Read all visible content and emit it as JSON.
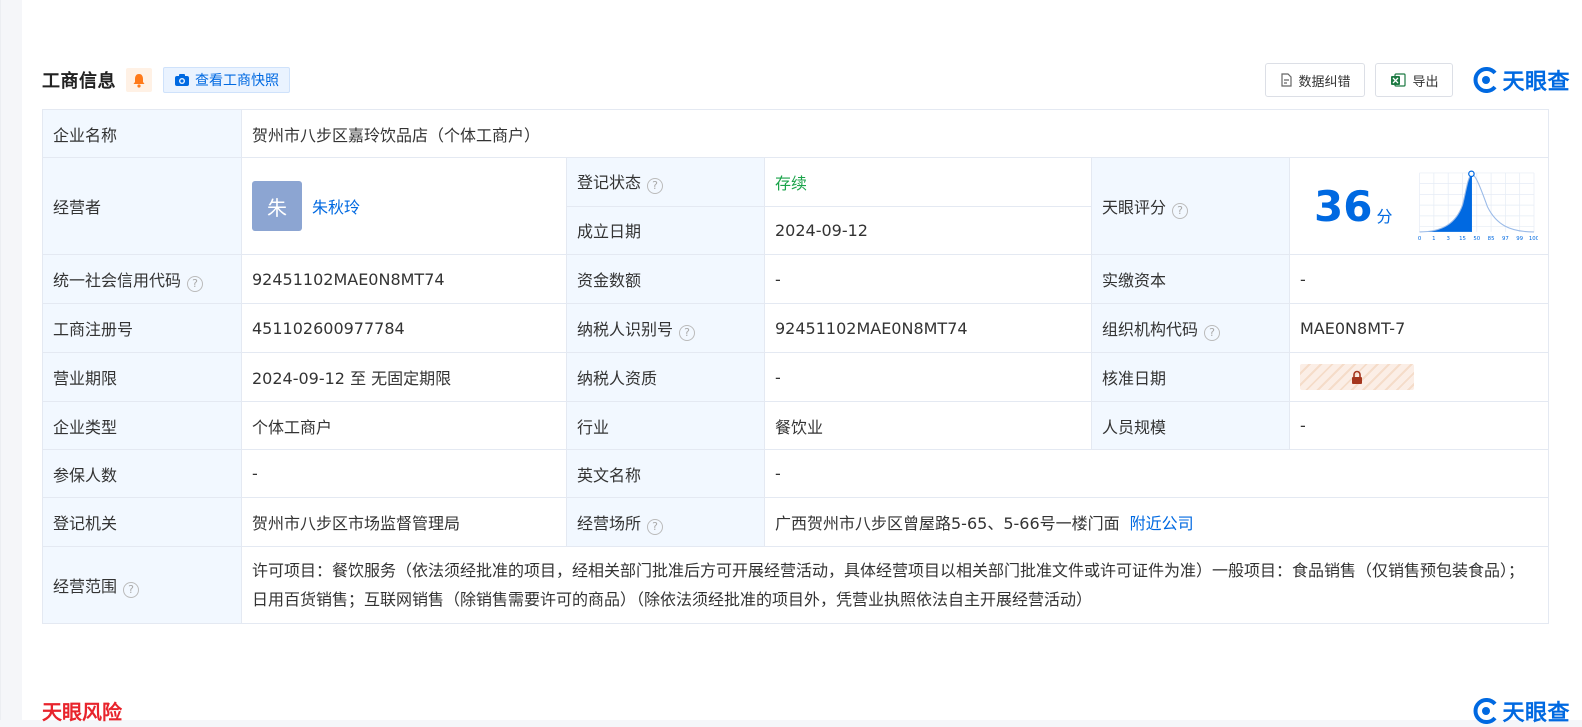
{
  "header": {
    "title": "工商信息",
    "snapshot_label": "查看工商快照",
    "correct_label": "数据纠错",
    "export_label": "导出",
    "logo_text": "天眼查"
  },
  "table": {
    "company_name_label": "企业名称",
    "company_name": "贺州市八步区嘉玲饮品店（个体工商户）",
    "operator_label": "经营者",
    "operator_avatar": "朱",
    "operator_name": "朱秋玲",
    "reg_status_label": "登记状态",
    "reg_status": "存续",
    "est_date_label": "成立日期",
    "est_date": "2024-09-12",
    "tianyan_score_label": "天眼评分",
    "score": "36",
    "score_unit": "分",
    "score_axis": [
      "0",
      "1",
      "3",
      "15",
      "50",
      "85",
      "97",
      "99",
      "100"
    ],
    "credit_code_label": "统一社会信用代码",
    "credit_code": "92451102MAE0N8MT74",
    "fund_label": "资金数额",
    "fund": "-",
    "paid_capital_label": "实缴资本",
    "paid_capital": "-",
    "reg_no_label": "工商注册号",
    "reg_no": "451102600977784",
    "taxpayer_id_label": "纳税人识别号",
    "taxpayer_id": "92451102MAE0N8MT74",
    "org_code_label": "组织机构代码",
    "org_code": "MAE0N8MT-7",
    "biz_term_label": "营业期限",
    "biz_term": "2024-09-12 至 无固定期限",
    "taxpayer_qual_label": "纳税人资质",
    "taxpayer_qual": "-",
    "approve_date_label": "核准日期",
    "company_type_label": "企业类型",
    "company_type": "个体工商户",
    "industry_label": "行业",
    "industry": "餐饮业",
    "staff_size_label": "人员规模",
    "staff_size": "-",
    "insured_label": "参保人数",
    "insured": "-",
    "english_name_label": "英文名称",
    "english_name": "-",
    "reg_authority_label": "登记机关",
    "reg_authority": "贺州市八步区市场监督管理局",
    "biz_address_label": "经营场所",
    "biz_address": "广西贺州市八步区曾屋路5-65、5-66号一楼门面",
    "nearby_label": "附近公司",
    "scope_label": "经营范围",
    "scope": "许可项目：餐饮服务（依法须经批准的项目，经相关部门批准后方可开展经营活动，具体经营项目以相关部门批准文件或许可证件为准）一般项目：食品销售（仅销售预包装食品）；日用百货销售；互联网销售（除销售需要许可的商品）（除依法须经批准的项目外，凭营业执照依法自主开展经营活动）"
  },
  "footer": {
    "risk_title": "天眼风险",
    "logo_text": "天眼查"
  },
  "colors": {
    "brand": "#0069e1",
    "label_bg": "#f2f8ff",
    "status_green": "#1aa34a",
    "risk_red": "#e8242c"
  }
}
